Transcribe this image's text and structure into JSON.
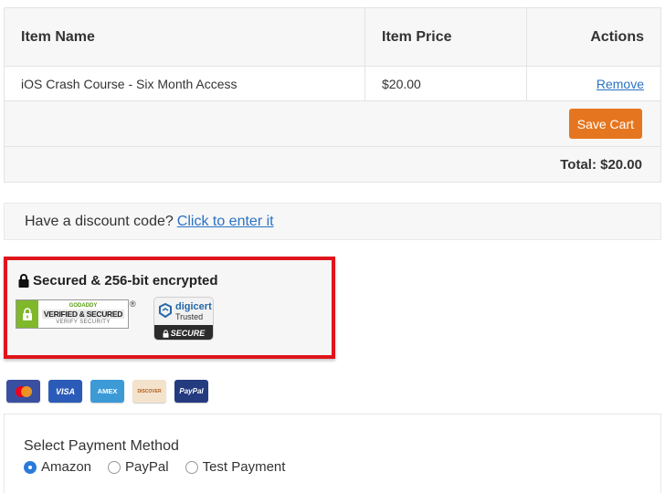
{
  "cart": {
    "headers": [
      "Item Name",
      "Item Price",
      "Actions"
    ],
    "items": [
      {
        "name": "iOS Crash Course - Six Month Access",
        "price": "$20.00",
        "action": "Remove"
      }
    ],
    "save_label": "Save Cart",
    "total": "Total: $20.00"
  },
  "discount": {
    "text": "Have a discount code?",
    "link": "Click to enter it"
  },
  "security": {
    "title": "Secured & 256-bit encrypted",
    "godaddy": {
      "brand": "GODADDY",
      "line1": "VERIFIED & SECURED",
      "line2": "VERIFY SECURITY",
      "reg": "®"
    },
    "digicert": {
      "name": "digicert",
      "trusted": "Trusted",
      "secure": "SECURE"
    }
  },
  "cards": [
    {
      "name": "mastercard-icon",
      "label": ""
    },
    {
      "name": "visa-icon",
      "label": "VISA"
    },
    {
      "name": "amex-icon",
      "label": "AMEX"
    },
    {
      "name": "discover-icon",
      "label": "DISCOVER"
    },
    {
      "name": "paypal-icon",
      "label": "PayPal"
    }
  ],
  "payment": {
    "title": "Select Payment Method",
    "options": [
      "Amazon",
      "PayPal",
      "Test Payment"
    ],
    "selected": "Amazon"
  },
  "colors": {
    "accent_orange": "#e5761f",
    "link_blue": "#2a73c4",
    "highlight_red": "#e0141b"
  }
}
